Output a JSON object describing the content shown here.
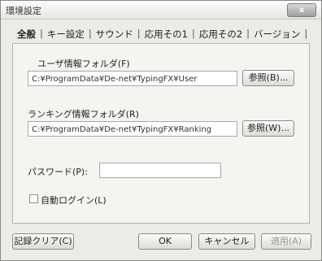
{
  "window": {
    "title": "環境設定",
    "close_label": "x"
  },
  "tabs": [
    {
      "label": "全般",
      "active": true
    },
    {
      "label": "キー設定",
      "active": false
    },
    {
      "label": "サウンド",
      "active": false
    },
    {
      "label": "応用その1",
      "active": false
    },
    {
      "label": "応用その2",
      "active": false
    },
    {
      "label": "バージョン",
      "active": false
    }
  ],
  "tab_separator": "|",
  "general": {
    "user_folder_label": "ユーザ情報フォルダ(F)",
    "user_folder_value": "C:¥ProgramData¥De-net¥TypingFX¥User",
    "user_browse_label": "参照(B)...",
    "ranking_folder_label": "ランキング情報フォルダ(R)",
    "ranking_folder_value": "C:¥ProgramData¥De-net¥TypingFX¥Ranking",
    "ranking_browse_label": "参照(W)...",
    "password_label": "パスワード(P):",
    "password_value": "",
    "autologin_label": "自動ログイン(L)",
    "autologin_checked": false
  },
  "footer": {
    "clear_record_label": "記録クリア(C)",
    "ok_label": "OK",
    "cancel_label": "キャンセル",
    "apply_label": "適用(A)"
  }
}
